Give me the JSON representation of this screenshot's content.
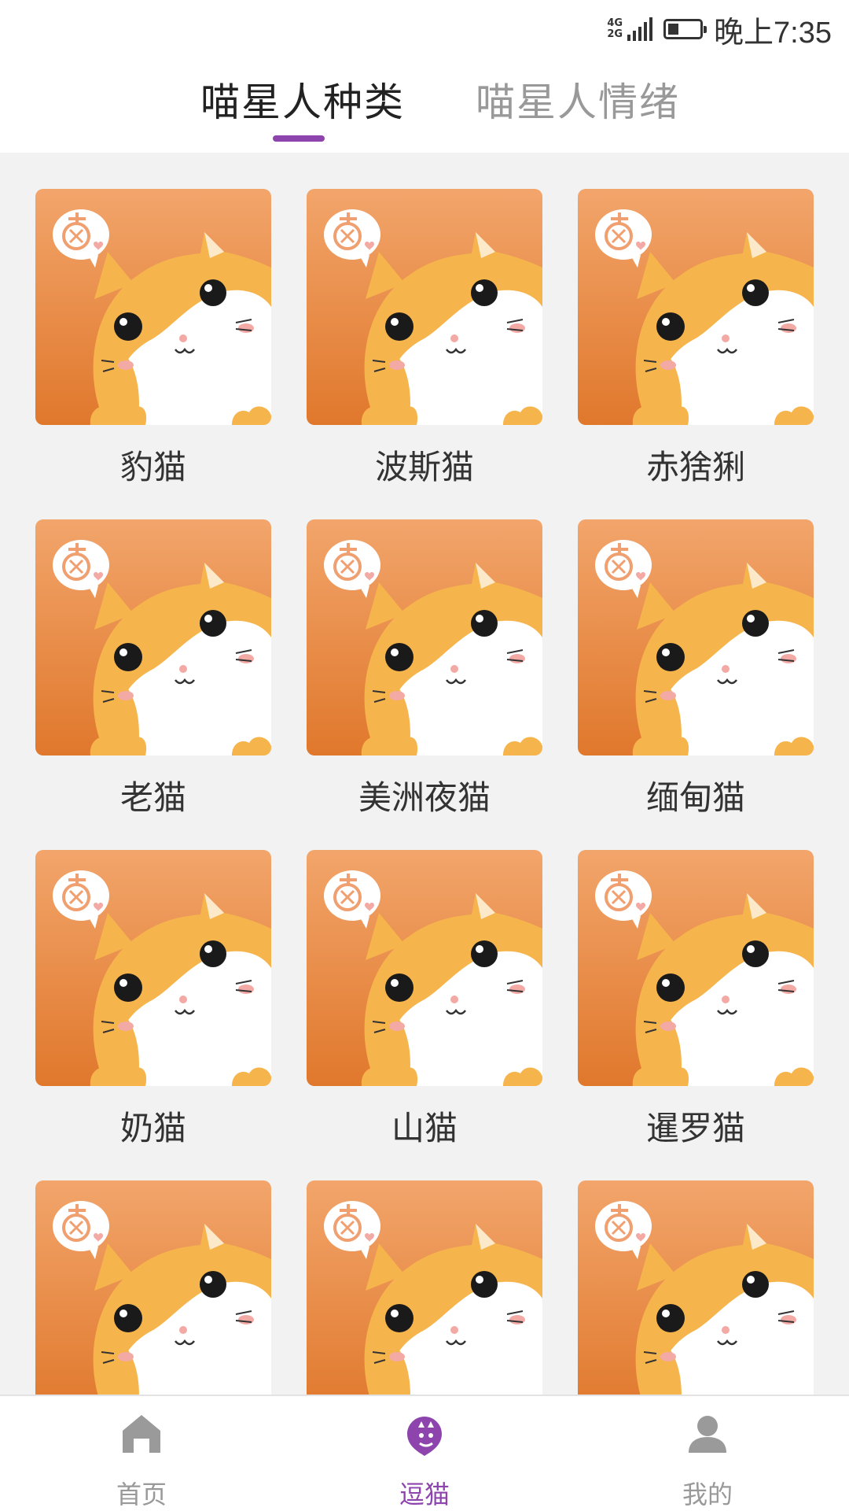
{
  "status_bar": {
    "network_top": "4G",
    "network_bottom": "2G",
    "time": "晚上7:35",
    "battery_level": 0.3,
    "battery_icon": "battery-icon",
    "signal_icon": "signal-icon"
  },
  "tabs": [
    {
      "label": "喵星人种类",
      "active": true
    },
    {
      "label": "喵星人情绪",
      "active": false
    }
  ],
  "accent_color": "#8e44ad",
  "cats": [
    {
      "name": "豹猫"
    },
    {
      "name": "波斯猫"
    },
    {
      "name": "赤猞猁"
    },
    {
      "name": "老猫"
    },
    {
      "name": "美洲夜猫"
    },
    {
      "name": "缅甸猫"
    },
    {
      "name": "奶猫"
    },
    {
      "name": "山猫"
    },
    {
      "name": "暹罗猫"
    },
    {
      "name": ""
    },
    {
      "name": ""
    },
    {
      "name": ""
    }
  ],
  "bottom_nav": {
    "items": [
      {
        "label": "首页",
        "icon": "home-icon",
        "active": false
      },
      {
        "label": "逗猫",
        "icon": "cat-tease-icon",
        "active": true
      },
      {
        "label": "我的",
        "icon": "profile-icon",
        "active": false
      }
    ]
  }
}
